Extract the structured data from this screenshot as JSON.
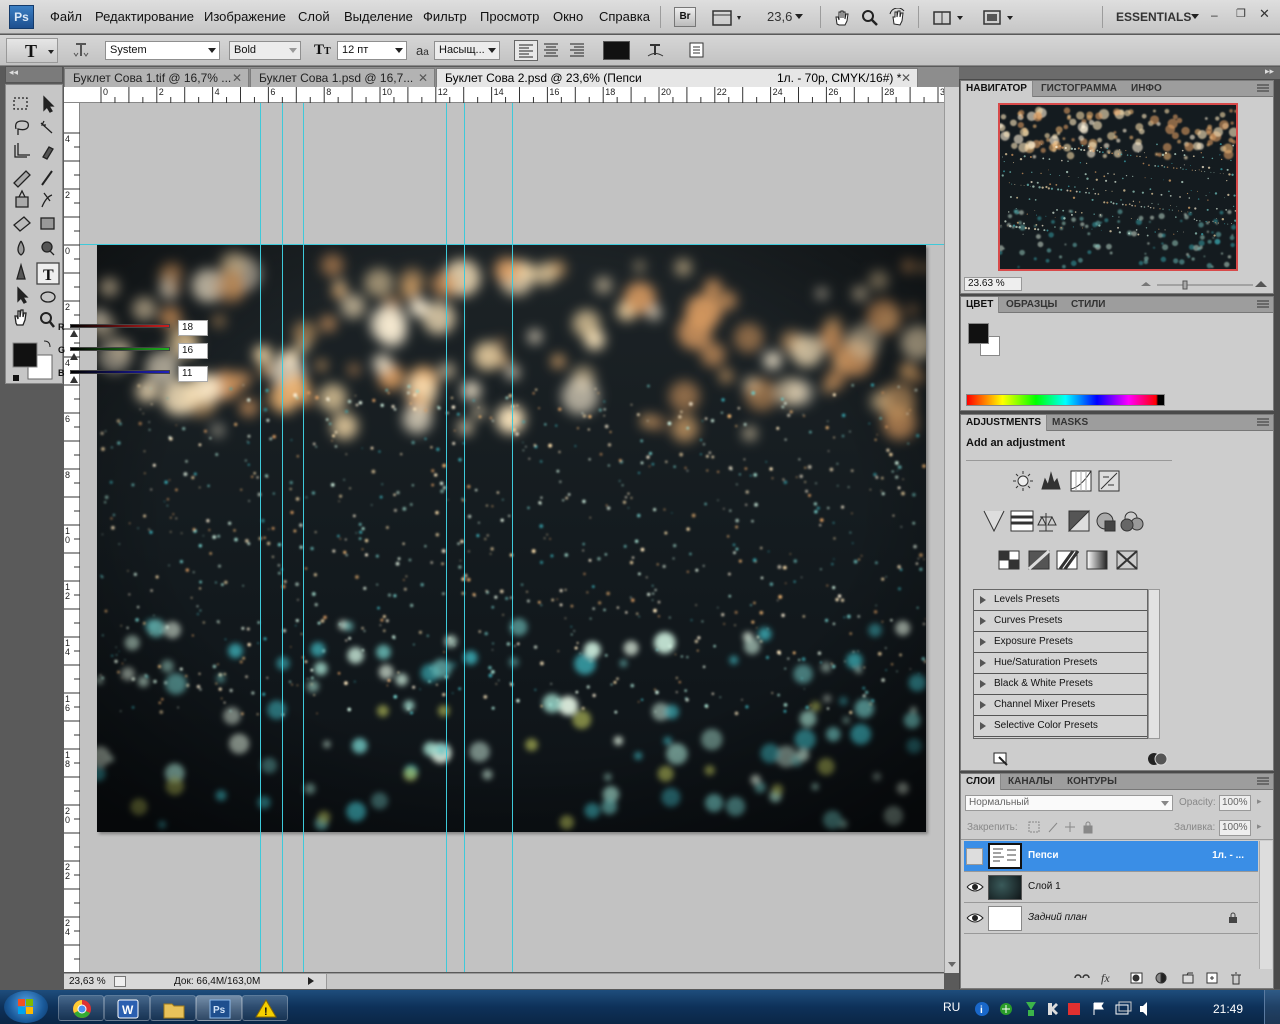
{
  "app": {
    "logo": "Ps",
    "workspace": "ESSENTIALS"
  },
  "menu": [
    "Файл",
    "Редактирование",
    "Изображение",
    "Слой",
    "Выделение",
    "Фильтр",
    "Просмотр",
    "Окно",
    "Справка"
  ],
  "appbar": {
    "bridge_label": "Br",
    "zoom": "23,6"
  },
  "options": {
    "tool_letter": "T",
    "font_family": "System",
    "font_style": "Bold",
    "font_size": "12 пт",
    "antialias": "Насыщ...",
    "color": "#111111"
  },
  "tabs": [
    {
      "label": "Буклет Сова 1.tif @ 16,7% ..."
    },
    {
      "label": "Буклет Сова 1.psd @ 16,7..."
    },
    {
      "label": "Буклет Сова 2.psd @ 23,6% (Пепси",
      "extra": "1л. - 70р, CMYK/16#) *"
    }
  ],
  "ruler_h": [
    "0",
    "2",
    "4",
    "6",
    "8",
    "10",
    "12",
    "14",
    "16",
    "18",
    "20",
    "22",
    "24",
    "26",
    "28",
    "30"
  ],
  "ruler_v": [
    "4",
    "2",
    "0",
    "2",
    "4",
    "6",
    "8",
    "1\n0",
    "1\n2",
    "1\n4",
    "1\n6",
    "1\n8",
    "2\n0",
    "2\n2",
    "2\n4"
  ],
  "status": {
    "zoom": "23,63 %",
    "doc": "Док: 66,4M/163,0M"
  },
  "navigator": {
    "tabs": [
      "НАВИГАТОР",
      "ГИСТОГРАММА",
      "ИНФО"
    ],
    "zoom": "23.63 %"
  },
  "color_panel": {
    "tabs": [
      "ЦВЕТ",
      "ОБРАЗЦЫ",
      "СТИЛИ"
    ],
    "channels": [
      {
        "label": "R",
        "value": "18",
        "color": "#cc2020"
      },
      {
        "label": "G",
        "value": "16",
        "color": "#20b020"
      },
      {
        "label": "B",
        "value": "11",
        "color": "#2020c0"
      }
    ]
  },
  "adjustments": {
    "tabs": [
      "ADJUSTMENTS",
      "MASKS"
    ],
    "title": "Add an adjustment",
    "presets": [
      "Levels Presets",
      "Curves Presets",
      "Exposure Presets",
      "Hue/Saturation Presets",
      "Black & White Presets",
      "Channel Mixer Presets",
      "Selective Color Presets"
    ]
  },
  "layers": {
    "tabs": [
      "СЛОИ",
      "КАНАЛЫ",
      "КОНТУРЫ"
    ],
    "blend_mode": "Нормальный",
    "opacity_label": "Opacity:",
    "opacity": "100%",
    "lock_label": "Закрепить:",
    "fill_label": "Заливка:",
    "fill": "100%",
    "items": [
      {
        "name": "Пепси",
        "extra": "1л. - ...",
        "selected": true,
        "visible": false
      },
      {
        "name": "Слой 1",
        "extra": "",
        "selected": false,
        "visible": true
      },
      {
        "name": "Задний план",
        "extra": "",
        "selected": false,
        "visible": true,
        "locked": true
      }
    ]
  },
  "taskbar": {
    "lang": "RU",
    "time": "21:49"
  }
}
